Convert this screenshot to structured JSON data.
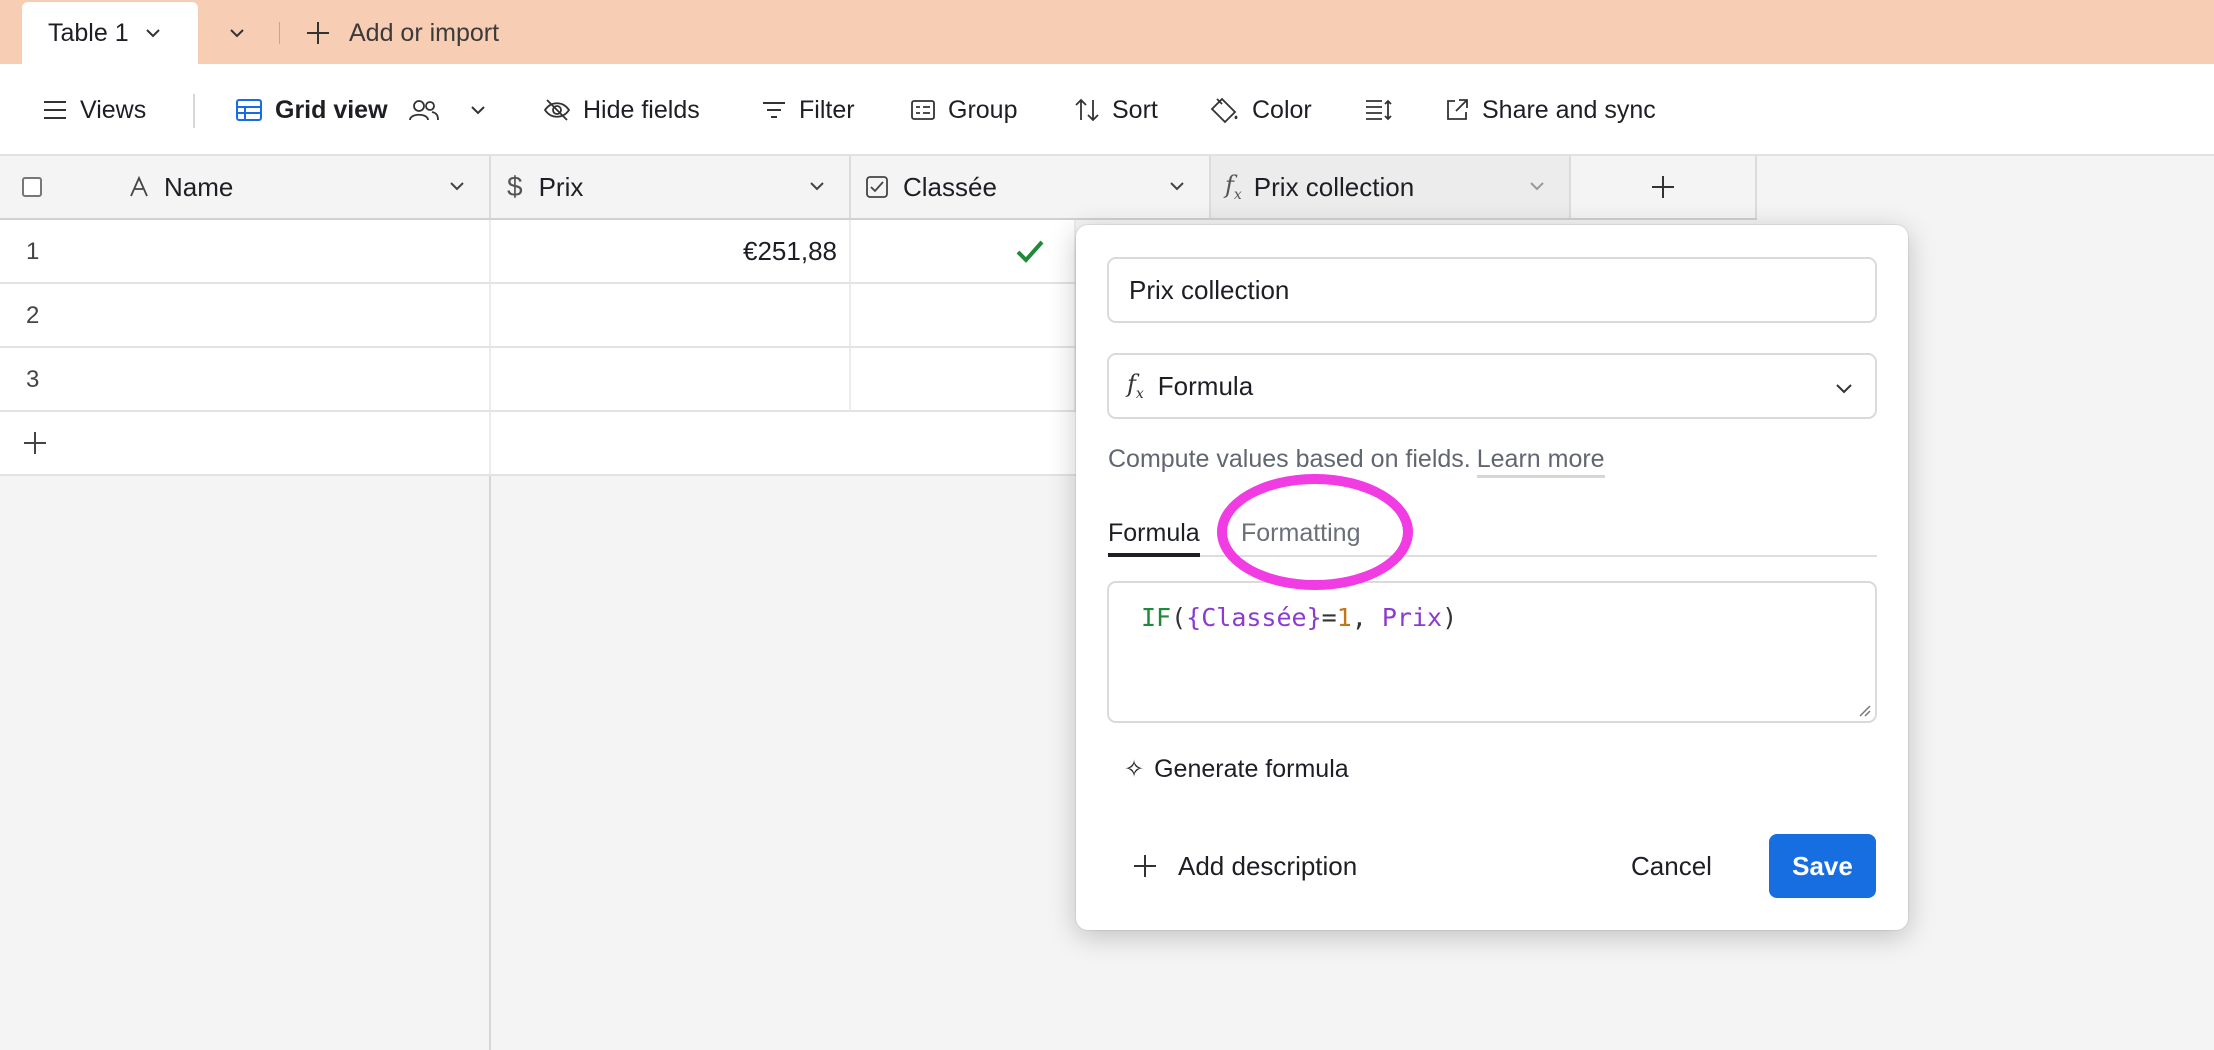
{
  "tabbar": {
    "active_table": "Table 1",
    "add_label": "Add or import",
    "icons": [
      "chevron-down-icon",
      "plus-icon"
    ],
    "bg_color": "#f7cdb3"
  },
  "toolbar": {
    "views": "Views",
    "grid_view": "Grid view",
    "hide_fields": "Hide fields",
    "filter": "Filter",
    "group": "Group",
    "sort": "Sort",
    "color": "Color",
    "share": "Share and sync"
  },
  "grid": {
    "columns": [
      {
        "label": "Name",
        "icon": "text-icon"
      },
      {
        "label": "Prix",
        "icon": "currency-icon"
      },
      {
        "label": "Classée",
        "icon": "checkbox-icon"
      },
      {
        "label": "Prix collection",
        "icon": "formula-icon"
      }
    ],
    "rows": [
      {
        "num": "1",
        "prix": "€251,88",
        "classee": true
      },
      {
        "num": "2",
        "prix": "",
        "classee": false
      },
      {
        "num": "3",
        "prix": "",
        "classee": false
      }
    ]
  },
  "popup": {
    "field_name": "Prix collection",
    "field_type": "Formula",
    "description": "Compute values based on fields.",
    "learn_more": "Learn more",
    "tab_formula": "Formula",
    "tab_formatting": "Formatting",
    "formula": {
      "fn": "IF",
      "open": "(",
      "field1": "{Classée}",
      "eq": "=",
      "num": "1",
      "comma": ", ",
      "field2": "Prix",
      "close": ")"
    },
    "generate": "Generate formula",
    "add_description": "Add description",
    "cancel": "Cancel",
    "save": "Save",
    "accent_color": "#166ee1",
    "highlight_color": "#f13be3"
  }
}
